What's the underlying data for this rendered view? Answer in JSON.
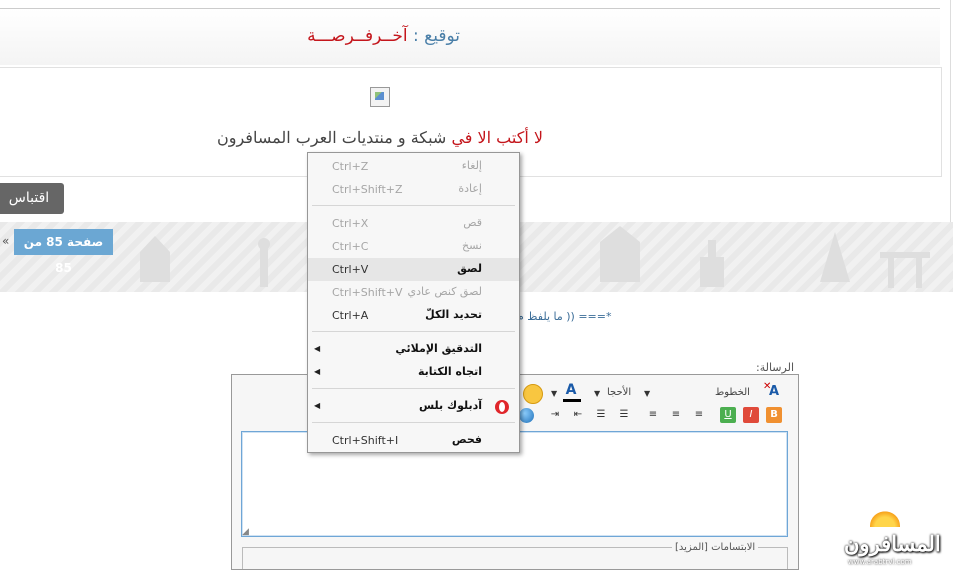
{
  "signature": {
    "label": "توقيع :",
    "name": "آخــرفــرصـــة",
    "line_red": "لا أكتب الا في",
    "line_rest": "شبكة و منتديات العرب المسافرون"
  },
  "buttons": {
    "quote": "اقتباس"
  },
  "pagination": {
    "page": "صفحة 85 من 85",
    "prev": "«"
  },
  "marquee": "*=== (( ما يلفظ م",
  "editor": {
    "message_label": "الرسالة:",
    "fonts_label": "الخطوط",
    "size_label": "الأحجا",
    "smilies_label": "الابتسامات [المزيد]"
  },
  "context_menu": {
    "items": [
      {
        "label": "إلغاء",
        "shortcut": "Ctrl+Z",
        "enabled": false
      },
      {
        "label": "إعادة",
        "shortcut": "Ctrl+Shift+Z",
        "enabled": false
      },
      {
        "label": "قص",
        "shortcut": "Ctrl+X",
        "enabled": false
      },
      {
        "label": "نسخ",
        "shortcut": "Ctrl+C",
        "enabled": false
      },
      {
        "label": "لصق",
        "shortcut": "Ctrl+V",
        "enabled": true,
        "highlighted": true
      },
      {
        "label": "لصق كنص عادي",
        "shortcut": "Ctrl+Shift+V",
        "enabled": false
      },
      {
        "label": "تحديد الكلّ",
        "shortcut": "Ctrl+A",
        "enabled": true
      },
      {
        "label": "التدقيق الإملائي",
        "shortcut": "",
        "enabled": true,
        "submenu": true
      },
      {
        "label": "اتجاه الكتابة",
        "shortcut": "",
        "enabled": true,
        "submenu": true
      },
      {
        "label": "آدبلوك بلس",
        "shortcut": "",
        "enabled": true,
        "submenu": true,
        "icon": "opera-icon"
      },
      {
        "label": "فحص",
        "shortcut": "Ctrl+Shift+I",
        "enabled": true
      }
    ]
  },
  "logo": {
    "text": "المسافرون",
    "sub": "www.arabtrvl.com"
  },
  "colors": {
    "accent": "#6ba7d3",
    "signature_name": "#c4161c",
    "menu_bg": "#f7f7f7"
  }
}
